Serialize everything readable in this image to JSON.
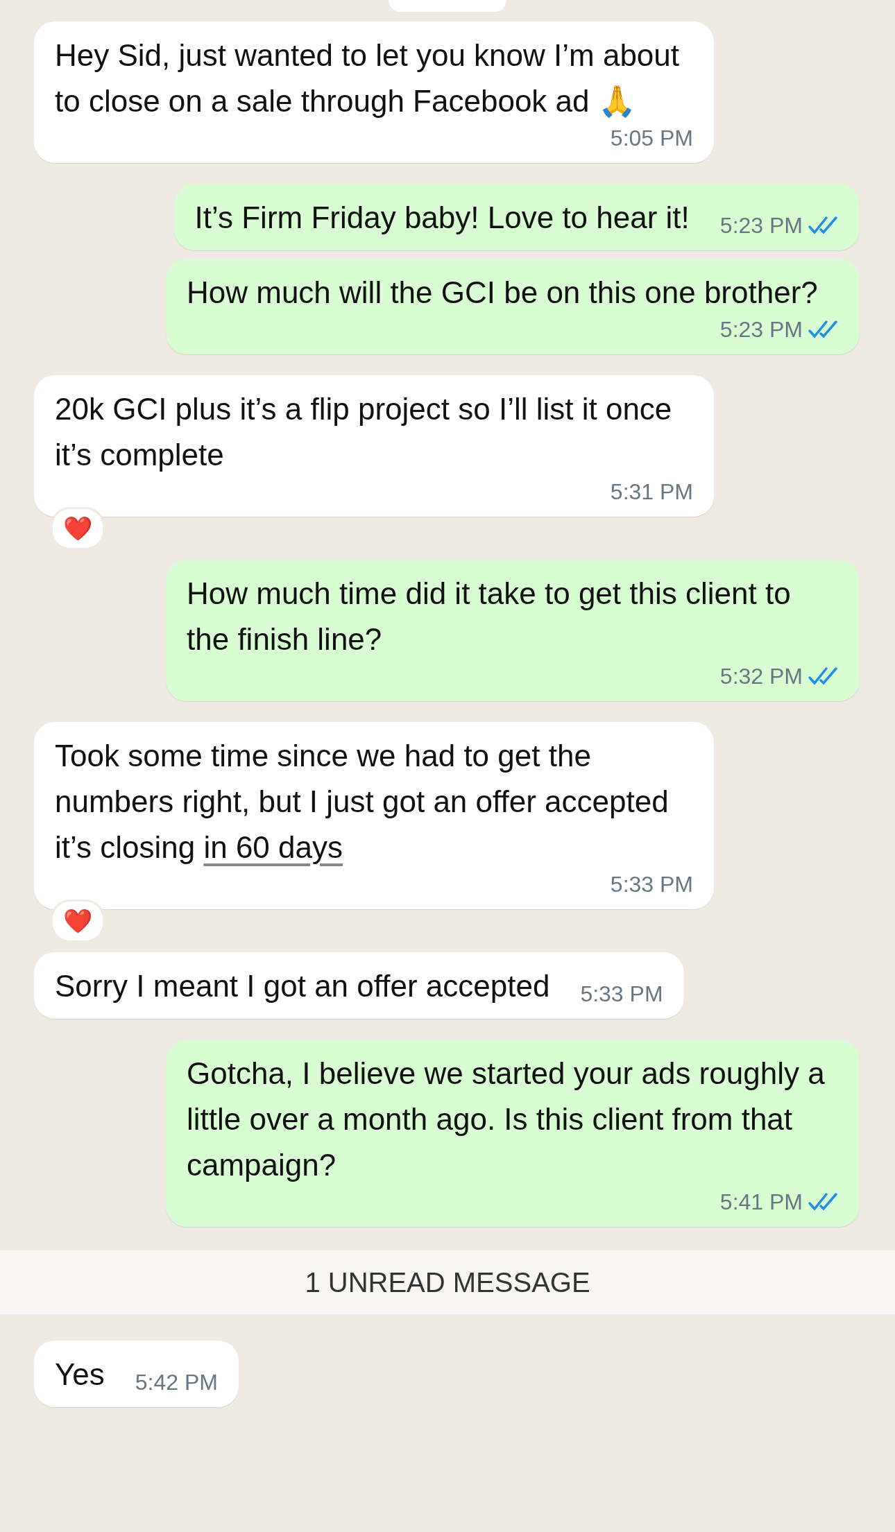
{
  "messages": [
    {
      "kind": "received",
      "text": "Hey Sid, just wanted to let you know I’m about to close on a sale through Facebook ad 🙏",
      "time": "5:05 PM"
    },
    {
      "kind": "sent",
      "text": "It’s Firm Friday baby! Love to hear it!",
      "time": "5:23 PM",
      "read": true
    },
    {
      "kind": "sent",
      "text": "How much will the GCI be on this one brother?",
      "time": "5:23 PM",
      "read": true
    },
    {
      "kind": "received",
      "text": "20k GCI plus it’s a flip project so I’ll list it once it’s complete",
      "time": "5:31 PM",
      "reaction": "❤️"
    },
    {
      "kind": "sent",
      "text": "How much time did it take to get this client to the finish line?",
      "time": "5:32 PM",
      "read": true
    },
    {
      "kind": "received",
      "text": "Took some time since we had to get the numbers right, but I just got an offer accepted it’s closing ",
      "link": "in 60 days",
      "time": "5:33 PM",
      "reaction": "❤️"
    },
    {
      "kind": "received",
      "text": "Sorry I meant I got an offer accepted",
      "time": "5:33 PM"
    },
    {
      "kind": "sent",
      "text": "Gotcha, I believe we started your ads roughly a little over a month ago. Is this client from that campaign?",
      "time": "5:41 PM",
      "read": true
    }
  ],
  "unread_banner": "1 UNREAD MESSAGE",
  "after_unread": [
    {
      "kind": "received",
      "text": "Yes",
      "time": "5:42 PM"
    }
  ]
}
